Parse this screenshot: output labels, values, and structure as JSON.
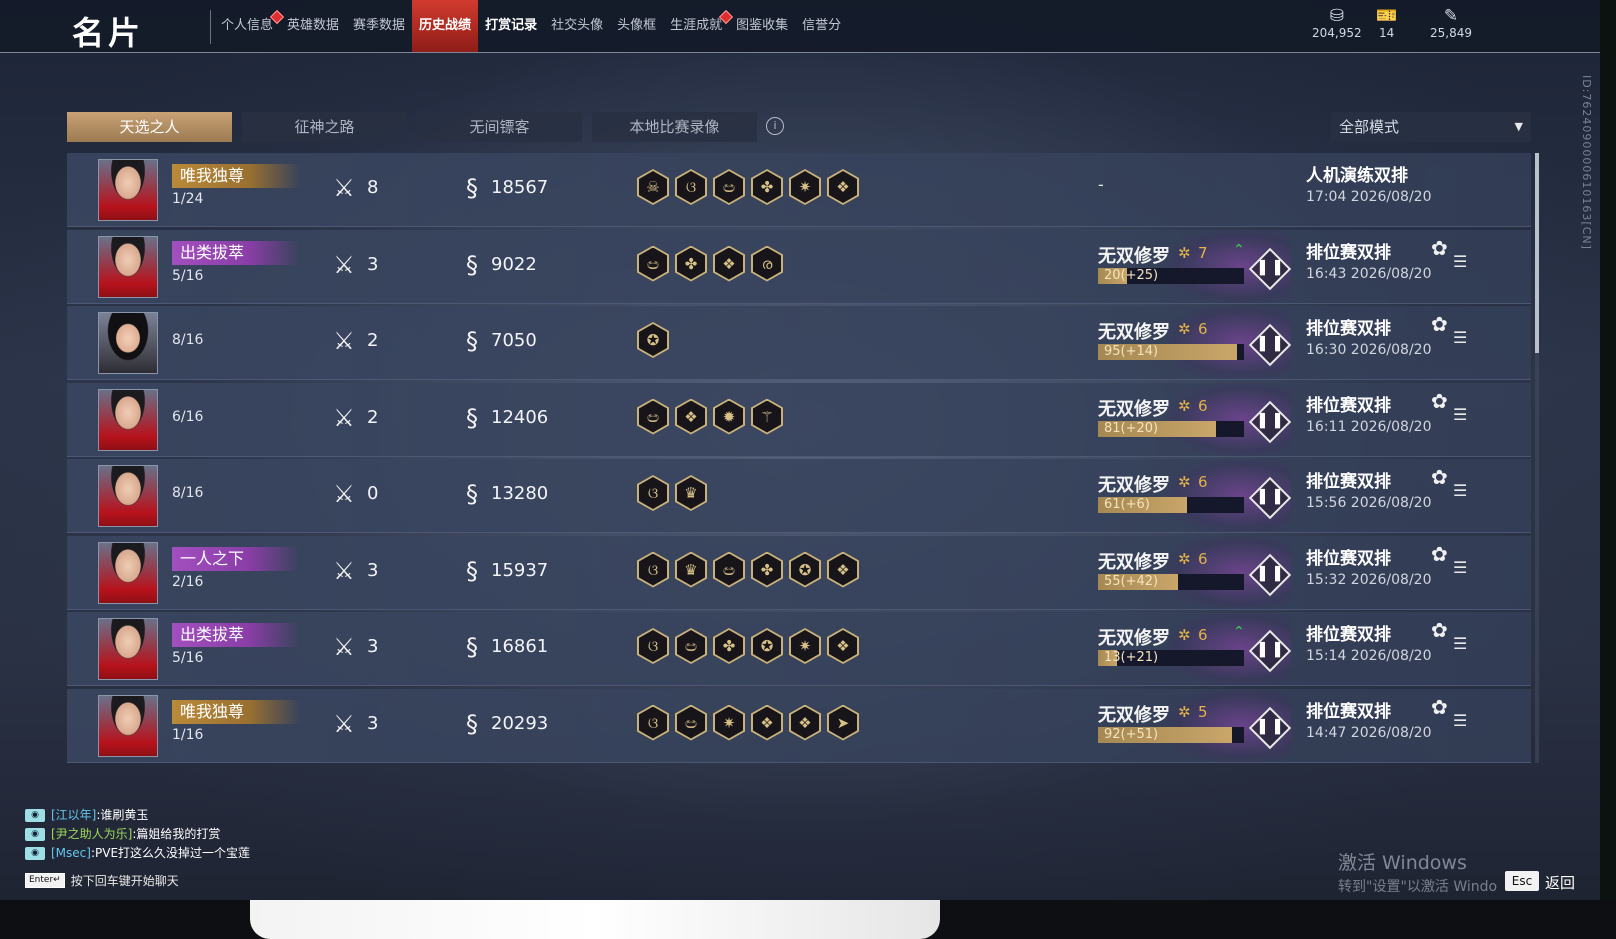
{
  "header": {
    "title": "名片",
    "nav": [
      {
        "label": "个人信息",
        "dot": true,
        "state": "normal"
      },
      {
        "label": "英雄数据",
        "dot": false,
        "state": "normal"
      },
      {
        "label": "赛季数据",
        "dot": false,
        "state": "normal"
      },
      {
        "label": "历史战绩",
        "dot": false,
        "state": "active"
      },
      {
        "label": "打赏记录",
        "dot": false,
        "state": "bold"
      },
      {
        "label": "社交头像",
        "dot": false,
        "state": "normal"
      },
      {
        "label": "头像框",
        "dot": false,
        "state": "normal"
      },
      {
        "label": "生涯成就",
        "dot": true,
        "state": "normal"
      },
      {
        "label": "图鉴收集",
        "dot": false,
        "state": "normal"
      },
      {
        "label": "信誉分",
        "dot": false,
        "state": "normal"
      }
    ],
    "currencies": [
      {
        "icon": "coin-stack-icon",
        "glyph": "⛁",
        "value": "204,952"
      },
      {
        "icon": "ticket-icon",
        "glyph": "🎫",
        "value": "14"
      },
      {
        "icon": "feather-icon",
        "glyph": "✎",
        "value": "25,849"
      }
    ]
  },
  "side_id": "ID:7624090000610163[CN]",
  "tabs": [
    {
      "label": "天选之人",
      "active": true
    },
    {
      "label": "征神之路",
      "active": false
    },
    {
      "label": "无间镖客",
      "active": false
    },
    {
      "label": "本地比赛录像",
      "active": false
    }
  ],
  "mode_filter": {
    "selected": "全部模式"
  },
  "matches": [
    {
      "avatar": "male",
      "title": "唯我独尊",
      "title_color": "gold",
      "placement": "1/24",
      "kills": "8",
      "damage": "18567",
      "items": [
        "☠",
        "ଓ",
        "ඏ",
        "✤",
        "✷",
        "❖"
      ],
      "ranked": false,
      "rank_placeholder": "-",
      "mode": "人机演练双排",
      "time": "17:04 2026/08/20"
    },
    {
      "avatar": "male",
      "title": "出类拔萃",
      "title_color": "purple",
      "placement": "5/16",
      "kills": "3",
      "damage": "9022",
      "items": [
        "ඏ",
        "✤",
        "❖",
        "ര"
      ],
      "ranked": true,
      "rank_name": "无双修罗",
      "stars": "7",
      "up": true,
      "points": "20(+25)",
      "progress": 0.2,
      "mode": "排位赛双排",
      "time": "16:43 2026/08/20"
    },
    {
      "avatar": "female",
      "title": "",
      "title_color": "",
      "placement": "8/16",
      "kills": "2",
      "damage": "7050",
      "items": [
        "✪"
      ],
      "ranked": true,
      "rank_name": "无双修罗",
      "stars": "6",
      "up": false,
      "points": "95(+14)",
      "progress": 0.95,
      "mode": "排位赛双排",
      "time": "16:30 2026/08/20"
    },
    {
      "avatar": "male",
      "title": "",
      "title_color": "",
      "placement": "6/16",
      "kills": "2",
      "damage": "12406",
      "items": [
        "ඏ",
        "❖",
        "✹",
        "⚚"
      ],
      "ranked": true,
      "rank_name": "无双修罗",
      "stars": "6",
      "up": false,
      "points": "81(+20)",
      "progress": 0.81,
      "mode": "排位赛双排",
      "time": "16:11 2026/08/20"
    },
    {
      "avatar": "male",
      "title": "",
      "title_color": "",
      "placement": "8/16",
      "kills": "0",
      "damage": "13280",
      "items": [
        "ଓ",
        "♛"
      ],
      "ranked": true,
      "rank_name": "无双修罗",
      "stars": "6",
      "up": false,
      "points": "61(+6)",
      "progress": 0.61,
      "mode": "排位赛双排",
      "time": "15:56 2026/08/20"
    },
    {
      "avatar": "male",
      "title": "一人之下",
      "title_color": "purple",
      "placement": "2/16",
      "kills": "3",
      "damage": "15937",
      "items": [
        "ଓ",
        "♛",
        "ඏ",
        "✤",
        "✪",
        "❖"
      ],
      "ranked": true,
      "rank_name": "无双修罗",
      "stars": "6",
      "up": false,
      "points": "55(+42)",
      "progress": 0.55,
      "mode": "排位赛双排",
      "time": "15:32 2026/08/20"
    },
    {
      "avatar": "male",
      "title": "出类拔萃",
      "title_color": "purple",
      "placement": "5/16",
      "kills": "3",
      "damage": "16861",
      "items": [
        "ଓ",
        "ඏ",
        "✤",
        "✪",
        "✷",
        "❖"
      ],
      "ranked": true,
      "rank_name": "无双修罗",
      "stars": "6",
      "up": true,
      "points": "13(+21)",
      "progress": 0.13,
      "mode": "排位赛双排",
      "time": "15:14 2026/08/20"
    },
    {
      "avatar": "male",
      "title": "唯我独尊",
      "title_color": "gold",
      "placement": "1/16",
      "kills": "3",
      "damage": "20293",
      "items": [
        "ଓ",
        "ඏ",
        "✷",
        "❖",
        "❖",
        "➤"
      ],
      "ranked": true,
      "rank_name": "无双修罗",
      "stars": "5",
      "up": false,
      "points": "92(+51)",
      "progress": 0.92,
      "mode": "排位赛双排",
      "time": "14:47 2026/08/20"
    }
  ],
  "chat": {
    "lines": [
      {
        "name": "[江以年]",
        "name_color": "blue",
        "msg": ":谁刷黄玉"
      },
      {
        "name": "[尹之助人为乐]",
        "name_color": "green",
        "msg": ":篇姐给我的打赏"
      },
      {
        "name": "[Msec]",
        "name_color": "blue",
        "msg": ":PVE打这么久没掉过一个宝莲"
      }
    ],
    "enter_key": "Enter↵",
    "hint": "按下回车键开始聊天"
  },
  "watermark": {
    "line1": "激活 Windows",
    "line2": "转到\"设置\"以激活 Windo"
  },
  "footer": {
    "esc": "Esc",
    "back": "返回"
  }
}
